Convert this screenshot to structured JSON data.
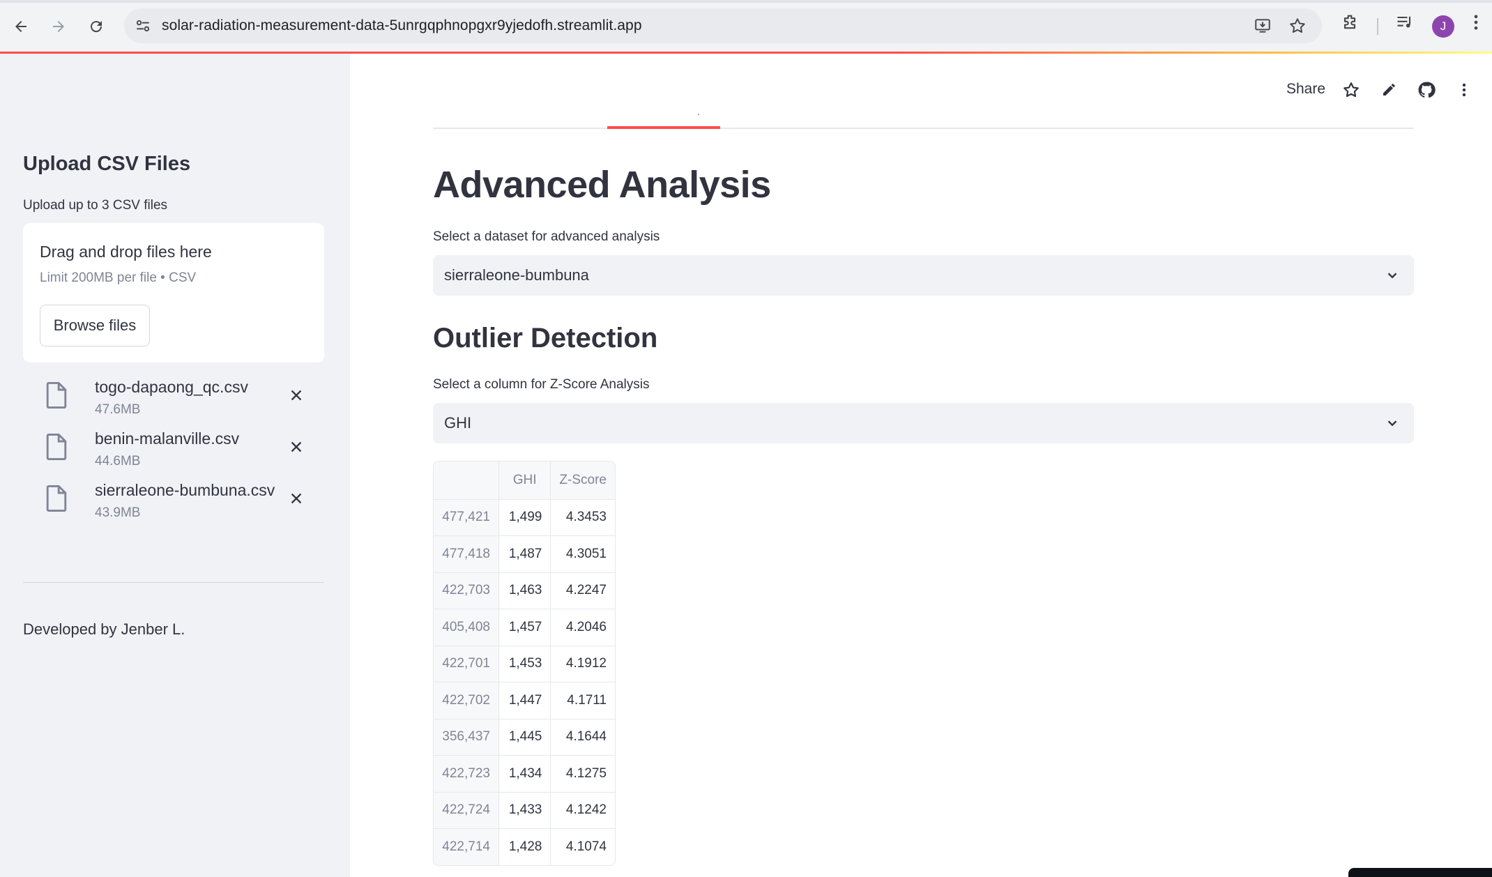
{
  "browser": {
    "url": "solar-radiation-measurement-data-5unrgqphnopgxr9yjedofh.streamlit.app",
    "profile_initial": "J"
  },
  "header": {
    "share_label": "Share"
  },
  "sidebar": {
    "title": "Upload CSV Files",
    "subtitle": "Upload up to 3 CSV files",
    "dropzone": {
      "title": "Drag and drop files here",
      "limit": "Limit 200MB per file • CSV",
      "browse_label": "Browse files"
    },
    "files": [
      {
        "name": "togo-dapaong_qc.csv",
        "size": "47.6MB"
      },
      {
        "name": "benin-malanville.csv",
        "size": "44.6MB"
      },
      {
        "name": "sierraleone-bumbuna.csv",
        "size": "43.9MB"
      }
    ],
    "footer": "Developed by Jenber L."
  },
  "main": {
    "title": "Advanced Analysis",
    "dataset_select": {
      "label": "Select a dataset for advanced analysis",
      "value": "sierraleone-bumbuna"
    },
    "section_title": "Outlier Detection",
    "column_select": {
      "label": "Select a column for Z-Score Analysis",
      "value": "GHI"
    },
    "table": {
      "columns": [
        "",
        "GHI",
        "Z-Score"
      ],
      "rows": [
        [
          "477,421",
          "1,499",
          "4.3453"
        ],
        [
          "477,418",
          "1,487",
          "4.3051"
        ],
        [
          "422,703",
          "1,463",
          "4.2247"
        ],
        [
          "405,408",
          "1,457",
          "4.2046"
        ],
        [
          "422,701",
          "1,453",
          "4.1912"
        ],
        [
          "422,702",
          "1,447",
          "4.1711"
        ],
        [
          "356,437",
          "1,445",
          "4.1644"
        ],
        [
          "422,723",
          "1,434",
          "4.1275"
        ],
        [
          "422,724",
          "1,433",
          "4.1242"
        ],
        [
          "422,714",
          "1,428",
          "4.1074"
        ]
      ]
    }
  },
  "colors": {
    "accent": "#ff4b4b",
    "sidebar_bg": "#f0f2f6",
    "text": "#31333f",
    "muted": "#808495"
  }
}
